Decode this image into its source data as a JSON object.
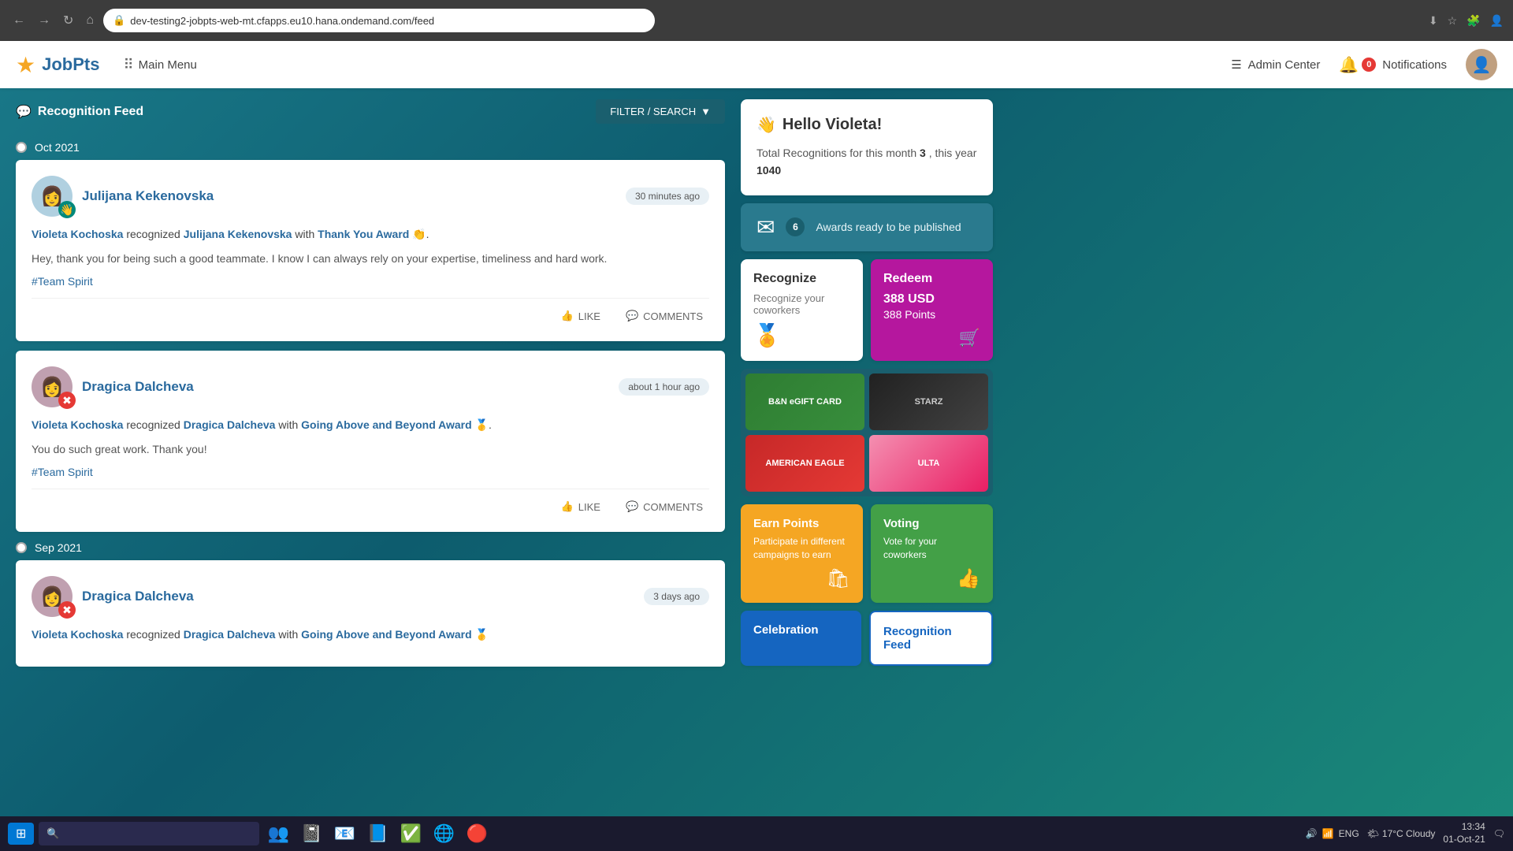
{
  "browser": {
    "address": "dev-testing2-jobpts-web-mt.cfapps.eu10.hana.ondemand.com/feed",
    "back_icon": "←",
    "forward_icon": "→",
    "reload_icon": "↻",
    "home_icon": "⌂",
    "lock_icon": "🔒"
  },
  "header": {
    "logo_icon": "★",
    "logo_text": "JobPts",
    "menu_icon": "⠿",
    "menu_label": "Main Menu",
    "admin_icon": "☰",
    "admin_label": "Admin Center",
    "notif_icon": "🔔",
    "notif_badge": "0",
    "notif_label": "Notifications"
  },
  "feed": {
    "title": "Recognition Feed",
    "title_icon": "💬",
    "filter_label": "FILTER / SEARCH",
    "filter_icon": "▼"
  },
  "timeline": [
    {
      "label": "Oct 2021"
    },
    {
      "label": "Sep 2021"
    }
  ],
  "cards": [
    {
      "id": 1,
      "user_name": "Julijana Kekenovska",
      "time": "30 minutes ago",
      "recognizer": "Violeta Kochoska",
      "recipient": "Julijana Kekenovska",
      "award": "Thank You Award",
      "award_emoji": "👏",
      "message": "Hey, thank you for being such a good teammate. I know I can always rely on your expertise, timeliness and hard work.",
      "hashtag": "#Team Spirit",
      "badge_color": "teal",
      "badge_icon": "👋",
      "like_label": "LIKE",
      "comment_label": "COMMENTS"
    },
    {
      "id": 2,
      "user_name": "Dragica Dalcheva",
      "time": "about 1 hour ago",
      "recognizer": "Violeta Kochoska",
      "recipient": "Dragica Dalcheva",
      "award": "Going Above and Beyond Award",
      "award_emoji": "🥇",
      "message": "You do such great work. Thank you!",
      "hashtag": "#Team Spirit",
      "badge_color": "red",
      "badge_icon": "✖",
      "like_label": "LIKE",
      "comment_label": "COMMENTS"
    },
    {
      "id": 3,
      "user_name": "Dragica Dalcheva",
      "time": "3 days ago",
      "recognizer": "Violeta Kochoska",
      "recipient": "Dragica Dalcheva",
      "award": "Going Above and Beyond Award",
      "award_emoji": "🥇",
      "message": "",
      "hashtag": "",
      "badge_color": "red",
      "badge_icon": "✖",
      "like_label": "LIKE",
      "comment_label": "COMMENTS"
    }
  ],
  "sidebar": {
    "hello_icon": "👋",
    "hello_name": "Hello Violeta!",
    "total_recognitions_label": "Total Recognitions for this month",
    "total_month": "3",
    "total_year_label": "this year",
    "total_year": "1040",
    "awards_icon": "✉",
    "awards_count": "6",
    "awards_label": "Awards ready to be published",
    "recognize_title": "Recognize",
    "recognize_sub": "Recognize your coworkers",
    "redeem_title": "Redeem",
    "redeem_amount": "388 USD",
    "redeem_points": "388 Points",
    "cart_icon": "🛒",
    "gift_cards": [
      {
        "name": "Barnes & Noble eGift Card",
        "class": "gc-barnes",
        "display": "B&N eGIFT CARD"
      },
      {
        "name": "Starz",
        "class": "gc-starz",
        "display": "STARZ"
      },
      {
        "name": "American Eagle",
        "class": "gc-eagle",
        "display": "AMERICAN EAGLE"
      },
      {
        "name": "Ulta",
        "class": "gc-ulta",
        "display": "ULTA"
      }
    ],
    "earn_points_title": "Earn Points",
    "earn_points_sub": "Participate in different campaigns to earn",
    "earn_icon": "🛍",
    "voting_title": "Voting",
    "voting_sub": "Vote for your coworkers",
    "vote_icon": "👍",
    "celebration_title": "Celebration",
    "recfeed_title": "Recognition Feed"
  },
  "taskbar": {
    "start_icon": "⊞",
    "search_placeholder": "🔍",
    "app_icons": [
      "👥",
      "📓",
      "📘",
      "📋",
      "🌐",
      "🔴"
    ],
    "weather": "17°C  Cloudy",
    "time": "13:34",
    "date": "01-Oct-21",
    "lang": "ENG"
  }
}
